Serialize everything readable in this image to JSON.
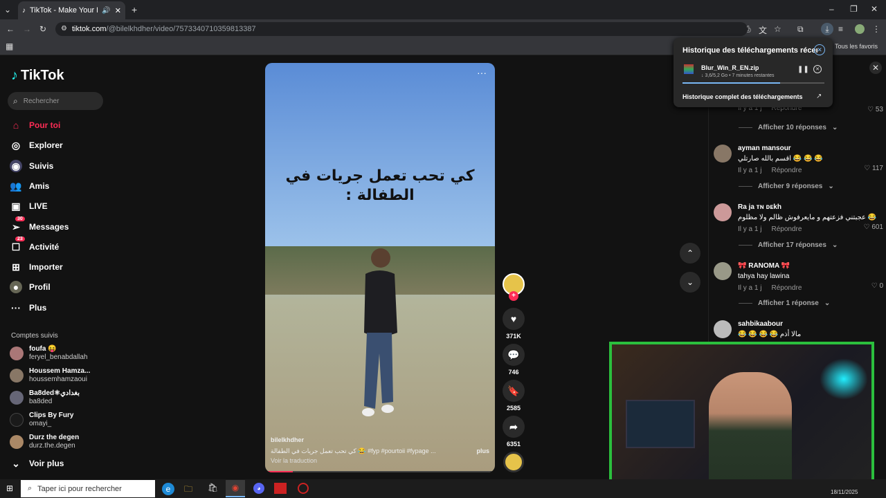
{
  "browser": {
    "tab_title": "TikTok - Make Your Day",
    "url_host": "tiktok.com",
    "url_path": "/@bilelkhdher/video/7573340710359813387",
    "bookmarks_label": "Tous les favoris"
  },
  "downloads": {
    "title": "Historique des téléchargements récents",
    "file_name": "Blur_Win_R_EN.zip",
    "file_status": "↓ 3,6/5,2 Go • 7 minutes restantes",
    "progress": 0.69,
    "full_history": "Historique complet des téléchargements"
  },
  "sidebar": {
    "logo": "TikTok",
    "search_placeholder": "Rechercher",
    "nav": [
      {
        "label": "Pour toi",
        "icon": "home-icon",
        "active": true
      },
      {
        "label": "Explorer",
        "icon": "compass-icon"
      },
      {
        "label": "Suivis",
        "icon": "following-icon"
      },
      {
        "label": "Amis",
        "icon": "friends-icon"
      },
      {
        "label": "LIVE",
        "icon": "live-icon"
      },
      {
        "label": "Messages",
        "icon": "messages-icon",
        "badge": "30"
      },
      {
        "label": "Activité",
        "icon": "activity-icon",
        "badge": "23"
      },
      {
        "label": "Importer",
        "icon": "upload-icon"
      },
      {
        "label": "Profil",
        "icon": "profile-icon"
      },
      {
        "label": "Plus",
        "icon": "more-icon"
      }
    ],
    "following_title": "Comptes suivis",
    "accounts": [
      {
        "name": "foufa 😝",
        "handle": "feryel_benabdallah"
      },
      {
        "name": "Houssem Hamza...",
        "handle": "houssemhamzaoui"
      },
      {
        "name": "Ba8ded⚛بغدادي",
        "handle": "ba8ded"
      },
      {
        "name": "Clips By Fury",
        "handle": "omayi_"
      },
      {
        "name": "Durz the degen",
        "handle": "durz.the.degen"
      }
    ],
    "see_more": "Voir plus"
  },
  "video": {
    "overlay_text_1": "كي تحب تعمل جريات في",
    "overlay_text_2": "الطفالة :",
    "author": "bilelkhdher",
    "caption": "كي تحب تعمل جريات في الطفالة 😂 #fyp #pourtoii #fypage ...",
    "more": "plus",
    "translate": "Voir la traduction"
  },
  "actions": {
    "likes": "371K",
    "comments": "746",
    "saves": "2585",
    "shares": "6351"
  },
  "comments": [
    {
      "meta_time": "Il y a 1 j",
      "reply": "Répondre",
      "likes": "53",
      "replies": "Afficher 10 réponses"
    },
    {
      "name": "ayman mansour",
      "text": "اقسم بالله صارتلي 😂 😂 😂",
      "meta_time": "Il y a 1 j",
      "reply": "Répondre",
      "likes": "117",
      "replies": "Afficher 9 réponses"
    },
    {
      "name": "Ra ja ᴛɴ ᴅᴇkh",
      "text": "عجبتني فزعتهم و مايعرفوش ظالم ولا مظلوم 😂",
      "meta_time": "Il y a 1 j",
      "reply": "Répondre",
      "likes": "601",
      "replies": "Afficher 17 réponses"
    },
    {
      "name": "🎀 RANOMA 🎀",
      "text": "tahya hay lawina",
      "meta_time": "Il y a 1 j",
      "reply": "Répondre",
      "likes": "0",
      "replies": "Afficher 1 réponse"
    },
    {
      "name": "sahbikaabour",
      "text": "😂 😂 😂 😂 مالا أذم"
    }
  ],
  "taskbar": {
    "search_placeholder": "Taper ici pour rechercher",
    "date": "18/11/2025"
  }
}
